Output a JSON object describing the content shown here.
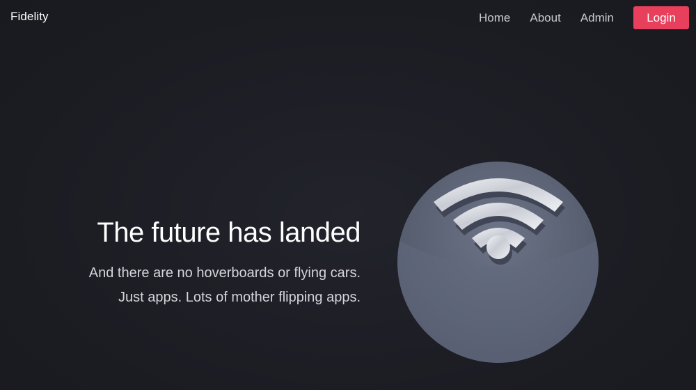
{
  "navbar": {
    "brand": "Fidelity",
    "links": [
      "Home",
      "About",
      "Admin"
    ],
    "login_label": "Login"
  },
  "hero": {
    "title": "The future has landed",
    "subtitle_line1": "And there are no hoverboards or flying cars.",
    "subtitle_line2": "Just apps. Lots of mother flipping apps."
  },
  "illustration": {
    "icon": "wifi-icon"
  },
  "colors": {
    "background": "#1c1d24",
    "accent": "#e8405c",
    "orb": "#5a6173"
  }
}
